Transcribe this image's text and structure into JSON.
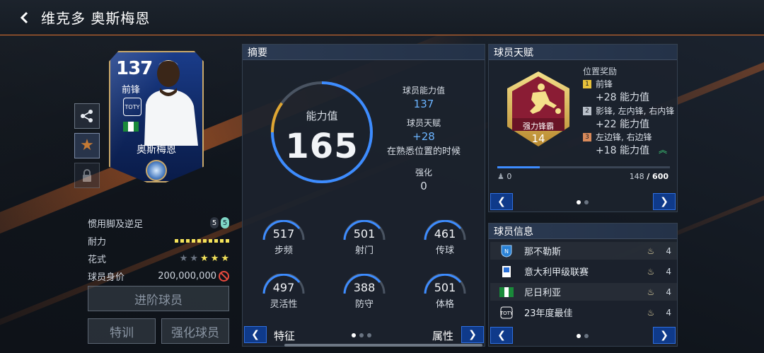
{
  "header": {
    "back_icon": "chevron-left-icon",
    "title": "维克多 奥斯梅恩"
  },
  "card": {
    "rating": "137",
    "position": "前锋",
    "name": "奥斯梅恩",
    "program_badge": "TOTY",
    "nation_flag_colors": [
      "#1a8a3a",
      "#ffffff",
      "#1a8a3a"
    ]
  },
  "side_actions": [
    {
      "icon": "share-icon"
    },
    {
      "icon": "star-icon"
    },
    {
      "icon": "lock-icon"
    }
  ],
  "attributes": {
    "weak_foot_label": "惯用脚及逆足",
    "weak_foot_left": "5",
    "weak_foot_right": "5",
    "stamina_label": "耐力",
    "stamina_level": 10,
    "skill_label": "花式",
    "skill_stars": 3,
    "skill_stars_max": 5,
    "value_label": "球员身价",
    "value": "200,000,000"
  },
  "buttons": {
    "advance": "进阶球员",
    "training": "特训",
    "enhance": "强化球员"
  },
  "summary": {
    "title": "摘要",
    "ovr_label": "能力值",
    "ovr_value": "165",
    "ovr_fill": 0.85,
    "player_ovr_label": "球员能力值",
    "player_ovr_value": "137",
    "talent_label": "球员天赋",
    "talent_value": "+28",
    "talent_note": "在熟悉位置的时候",
    "enhance_label": "强化",
    "enhance_value": "0",
    "stats": [
      {
        "value": "517",
        "label": "步频"
      },
      {
        "value": "501",
        "label": "射门"
      },
      {
        "value": "461",
        "label": "传球"
      },
      {
        "value": "497",
        "label": "灵活性"
      },
      {
        "value": "388",
        "label": "防守"
      },
      {
        "value": "501",
        "label": "体格"
      }
    ],
    "footer_left": "特征",
    "footer_right": "属性",
    "page_dots": 3,
    "active_dot": 0
  },
  "talent": {
    "title": "球员天赋",
    "badge_name": "强力锋霸",
    "badge_level": "14",
    "bonus_title": "位置奖励",
    "bonuses": [
      {
        "rank": "1",
        "rank_color": "#e8c23a",
        "positions": "前锋",
        "amount": "+28 能力值"
      },
      {
        "rank": "2",
        "rank_color": "#b9c0c9",
        "positions": "影锋, 左内锋, 右内锋",
        "amount": "+22 能力值"
      },
      {
        "rank": "3",
        "rank_color": "#d98a5a",
        "positions": "左边锋, 右边锋",
        "amount": "+18 能力值"
      }
    ],
    "progress_left": "0",
    "progress_current": "148",
    "progress_max": "/ 600",
    "progress_fraction": 0.247,
    "page_dots": 2,
    "active_dot": 0
  },
  "player_info": {
    "title": "球员信息",
    "rows": [
      {
        "icon": "club-badge-icon",
        "name": "那不勒斯",
        "level": "4"
      },
      {
        "icon": "league-badge-icon",
        "name": "意大利甲级联赛",
        "level": "4"
      },
      {
        "icon": "nation-flag-icon",
        "name": "尼日利亚",
        "level": "4"
      },
      {
        "icon": "toty-badge-icon",
        "name": "23年度最佳",
        "level": "4"
      }
    ],
    "page_dots": 2,
    "active_dot": 0
  },
  "colors": {
    "accent_blue": "#3d8cff",
    "accent_orange": "#e4742f",
    "gold": "#e8c23a"
  }
}
